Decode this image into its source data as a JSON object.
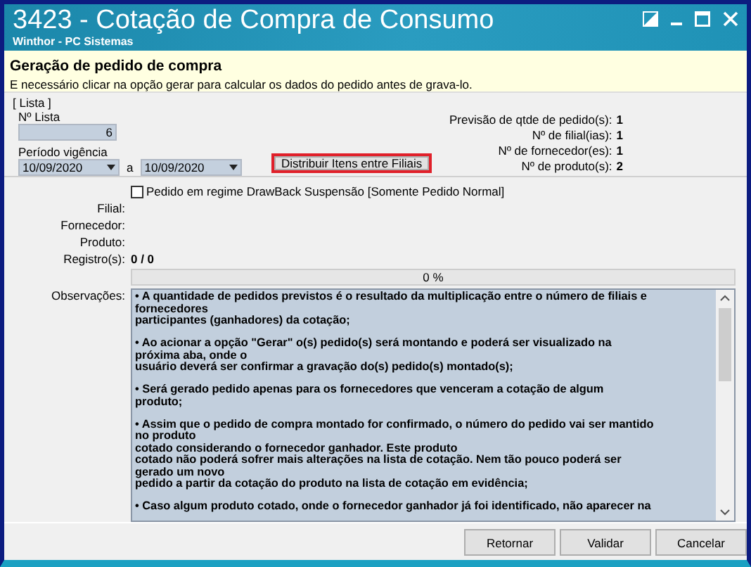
{
  "window": {
    "title": "3423 - Cotação de Compra de Consumo",
    "subtitle": "Winthor - PC Sistemas"
  },
  "header": {
    "title": "Geração de pedido de compra",
    "description": "E necessário clicar na opção gerar para calcular os dados do pedido antes de grava-lo."
  },
  "lista": {
    "group_label": "[ Lista ]",
    "list_number_label": "Nº Lista",
    "list_number": "6",
    "period_label": "Período vigência",
    "date_from": "10/09/2020",
    "date_separator": "a",
    "date_to": "10/09/2020",
    "distribute_button": {
      "label": "Distribuir Itens entre Filiais",
      "highlighted": true
    }
  },
  "summary": [
    {
      "label": "Previsão de qtde de pedido(s):",
      "value": "1"
    },
    {
      "label": "Nº de filial(ias):",
      "value": "1"
    },
    {
      "label": "Nº de fornecedor(es):",
      "value": "1"
    },
    {
      "label": "Nº de produto(s):",
      "value": "2"
    }
  ],
  "drawback_checkbox": {
    "label": "Pedido em regime DrawBack Suspensão [Somente Pedido Normal]",
    "checked": false
  },
  "details": [
    {
      "label": "Filial:"
    },
    {
      "label": "Fornecedor:"
    },
    {
      "label": "Produto:"
    },
    {
      "label": "Registro(s):",
      "value": "0 / 0"
    }
  ],
  "progress": {
    "level": 0,
    "reading": "0 %"
  },
  "observations": {
    "label": "Observações:",
    "paragraphs": [
      {
        "lines": [
          "• A quantidade de pedidos previstos é o resultado da multiplicação entre o número de filiais e",
          "fornecedores",
          "participantes (ganhadores) da cotação;"
        ]
      },
      {
        "lines": [
          "• Ao acionar a opção \"Gerar\" o(s) pedido(s) será montando e poderá ser visualizado na",
          "próxima aba, onde o",
          "usuário deverá ser confirmar a gravação do(s) pedido(s) montado(s);"
        ]
      },
      {
        "lines": [
          "• Será gerado pedido apenas para os fornecedores que venceram a cotação de algum",
          "produto;"
        ]
      },
      {
        "lines": [
          "• Assim que o pedido de compra montado for confirmado, o número do pedido vai ser mantido",
          "no produto",
          "cotado considerando o fornecedor ganhador. Este produto",
          "cotado não poderá sofrer mais alterações na lista de cotação. Nem tão pouco poderá ser",
          "gerado um novo",
          "pedido a partir da cotação do produto na lista de cotação em evidência;"
        ]
      },
      {
        "lines": [
          "• Caso algum produto cotado, onde o fornecedor ganhador já foi identificado, não aparecer na"
        ]
      }
    ]
  },
  "buttons": [
    {
      "label": "Retornar"
    },
    {
      "label": "Validar"
    },
    {
      "label": "Cancelar"
    }
  ]
}
